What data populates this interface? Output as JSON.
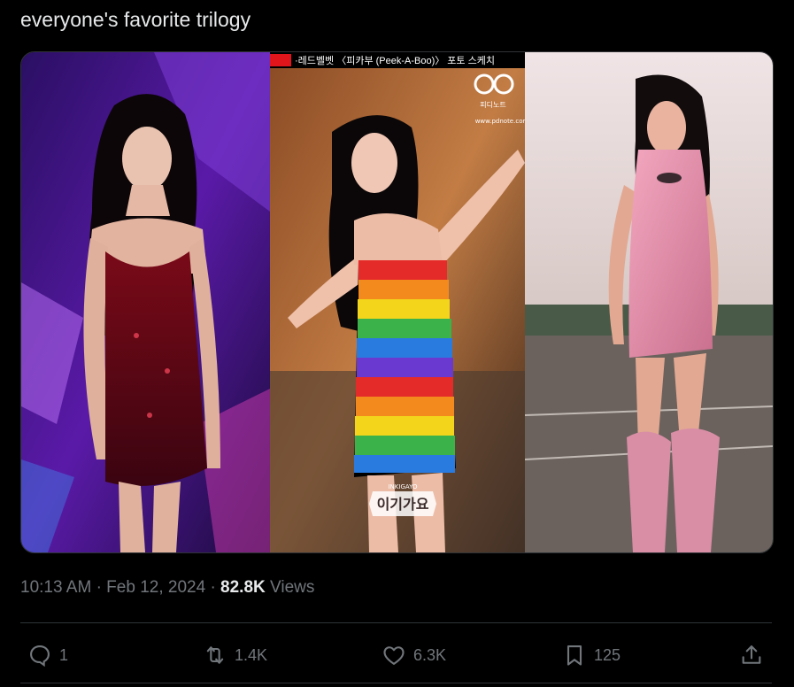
{
  "tweet": {
    "text": "everyone's favorite trilogy"
  },
  "media": {
    "caption_korean": "·레드벨벳 〈피카부 (Peek-A-Boo)〉 포토 스케치",
    "watermark_left": "피디노트",
    "watermark_bottom": "이기가요",
    "watermark_bottom_small": "INKIGAYO",
    "site_text": "www.pdnote.com"
  },
  "meta": {
    "time": "10:13 AM",
    "separator1": "·",
    "date": "Feb 12, 2024",
    "separator2": "·",
    "views_count": "82.8K",
    "views_label": "Views"
  },
  "actions": {
    "reply_count": "1",
    "retweet_count": "1.4K",
    "like_count": "6.3K",
    "bookmark_count": "125"
  },
  "colors": {
    "background": "#000000",
    "text_primary": "#e7e9ea",
    "text_secondary": "#71767b",
    "border": "#2f3336"
  }
}
